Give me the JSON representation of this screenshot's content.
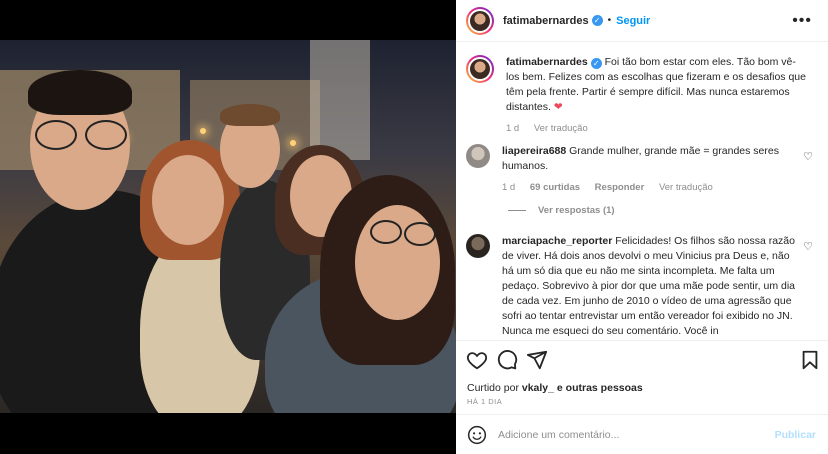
{
  "post": {
    "username": "fatimabernardes",
    "follow_label": "Seguir",
    "separator": "•",
    "more_label": "•••",
    "verified_glyph": "✓"
  },
  "caption": {
    "username": "fatimabernardes",
    "text": "Foi tão bom estar com eles. Tão bom vê-los bem. Felizes com as escolhas que fizeram e os desafios que têm pela frente. Partir é sempre difícil. Mas nunca estaremos distantes.",
    "heart": "❤",
    "age": "1 d",
    "translate": "Ver tradução"
  },
  "comments": [
    {
      "username": "liapereira688",
      "text": "Grande mulher, grande mãe = grandes seres humanos.",
      "age": "1 d",
      "likes": "69 curtidas",
      "reply": "Responder",
      "translate": "Ver tradução",
      "view_replies": "Ver respostas (1)"
    },
    {
      "username": "marciapache_reporter",
      "text": "Felicidades! Os filhos são nossa razão de viver. Há dois anos devolvi o meu Vinicius pra Deus e, não há um só dia que eu não me sinta incompleta. Me falta um pedaço. Sobrevivo à pior dor que uma mãe pode sentir, um dia de cada vez. Em junho de 2010 o vídeo de uma agressão que sofri ao tentar entrevistar um então vereador foi exibido no JN. Nunca me esqueci do seu comentário. Você in"
    }
  ],
  "engagement": {
    "liked_by_prefix": "Curtido por",
    "liked_by_user": "vkaly_",
    "liked_by_suffix": "e outras pessoas",
    "time": "HÁ 1 DIA"
  },
  "add_comment": {
    "placeholder": "Adicione um comentário...",
    "post_label": "Publicar"
  },
  "icons": [
    "heart-icon",
    "comment-icon",
    "share-icon",
    "bookmark-icon",
    "emoji-icon",
    "more-icon",
    "verified-icon"
  ],
  "colors": {
    "accent": "#0095f6",
    "verified": "#3897f0",
    "muted": "#8e8e8e",
    "heart_red": "#ed4956"
  }
}
